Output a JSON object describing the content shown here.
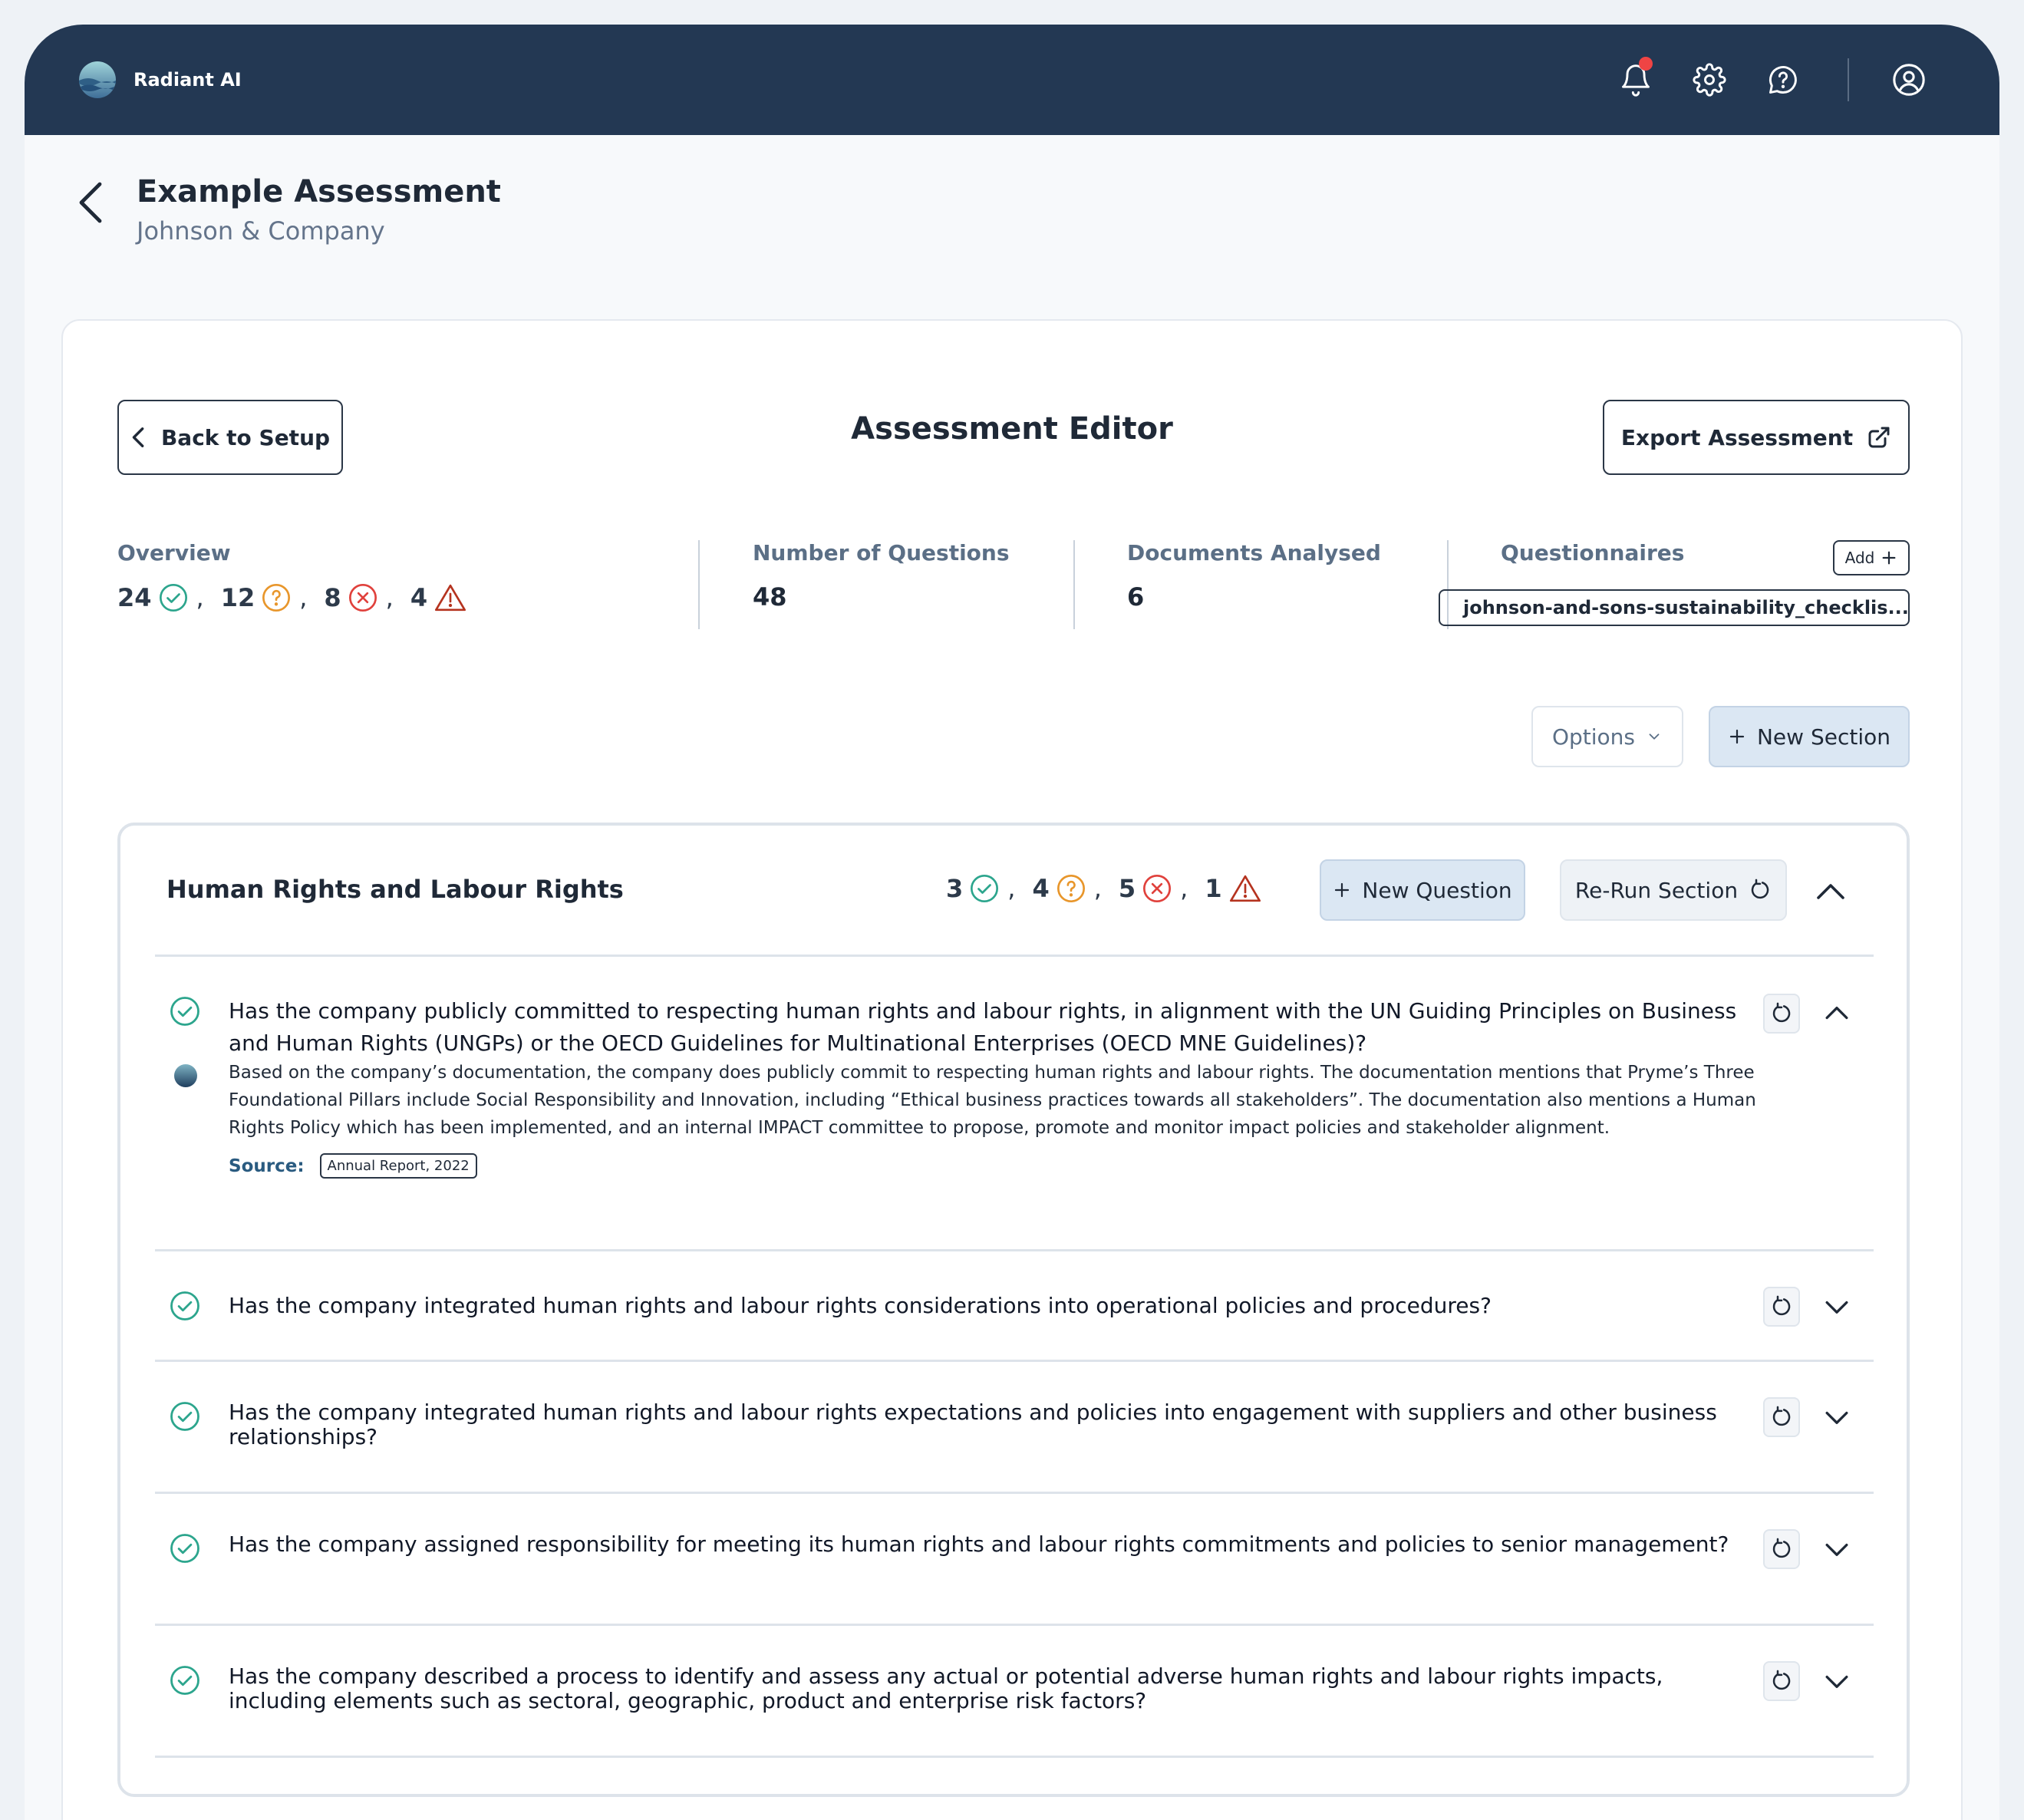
{
  "app": {
    "name": "Radiant AI"
  },
  "header": {
    "title": "Example Assessment",
    "subtitle": "Johnson & Company"
  },
  "editor": {
    "title": "Assessment Editor",
    "back_label": "Back to Setup",
    "export_label": "Export Assessment"
  },
  "stats": {
    "overview_label": "Overview",
    "overview_counts": {
      "passed": "24",
      "unclear": "12",
      "failed": "8",
      "warnings": "4"
    },
    "questions_label": "Number of Questions",
    "questions_value": "48",
    "documents_label": "Documents Analysed",
    "documents_value": "6",
    "questionnaires_label": "Questionnaires",
    "add_label": "Add",
    "questionnaire_file": "johnson-and-sons-sustainability_checklis..."
  },
  "toolbar": {
    "options_label": "Options",
    "new_section_label": "New Section"
  },
  "section": {
    "title": "Human Rights and Labour Rights",
    "counts": {
      "passed": "3",
      "unclear": "4",
      "failed": "5",
      "warnings": "1"
    },
    "new_question_label": "New Question",
    "rerun_label": "Re-Run Section",
    "questions": [
      {
        "text": "Has the company publicly committed to respecting human rights and labour rights, in alignment with the UN Guiding Principles on Business and Human Rights (UNGPs) or the OECD Guidelines for Multinational Enterprises (OECD MNE Guidelines)?",
        "answer": "Based on the company’s documentation, the company does publicly commit to respecting human rights and labour rights. The documentation mentions that Pryme’s Three Foundational Pillars include Social Responsibility and Innovation, including “Ethical business practices towards all stakeholders”. The documentation also mentions a Human Rights Policy which has been implemented, and an internal IMPACT committee  to propose, promote and monitor impact policies and stakeholder alignment.",
        "source_label": "Source:",
        "source": "Annual Report, 2022"
      },
      {
        "text": "Has the company integrated human rights and labour rights considerations into operational policies and procedures?"
      },
      {
        "text": "Has the company integrated human rights and labour rights expectations and policies into engagement with suppliers and other business relationships?"
      },
      {
        "text": "Has the company assigned responsibility for meeting its human rights and labour rights commitments and policies to senior management?"
      },
      {
        "text": "Has the company described a process to identify and assess any actual or potential adverse human rights and labour rights impacts, including elements such as sectoral, geographic, product and enterprise risk factors?"
      }
    ]
  },
  "colors": {
    "topbar": "#233853",
    "pass": "#2ca58d",
    "unclear": "#e8962b",
    "fail": "#e0413c",
    "warning": "#b5331f",
    "accent_button": "#dbe7f3"
  },
  "icons": [
    "bell-icon",
    "gear-icon",
    "help-icon",
    "user-icon",
    "chevron-left-icon",
    "external-link-icon",
    "check-circle-icon",
    "question-circle-icon",
    "x-circle-icon",
    "warning-icon",
    "plus-icon",
    "rerun-icon",
    "chevron-up-icon",
    "chevron-down-icon",
    "file-icon"
  ]
}
